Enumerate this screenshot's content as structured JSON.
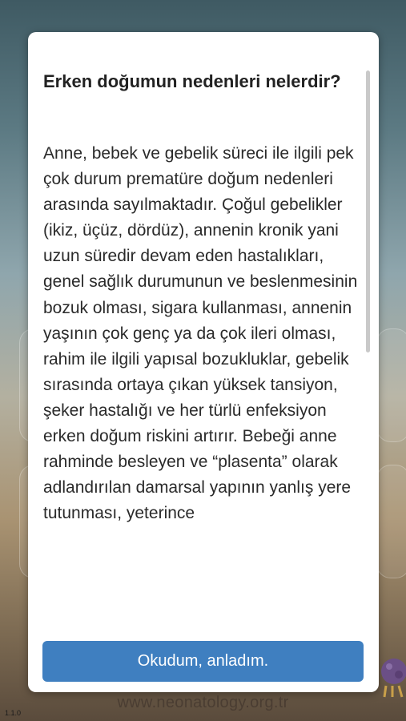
{
  "dialog": {
    "title": "Erken doğumun nedenleri nelerdir?",
    "body": "Anne, bebek ve gebelik süreci ile ilgili pek çok durum prematüre doğum nedenleri arasında sayılmaktadır. Çoğul gebelikler (ikiz, üçüz, dördüz), annenin kronik yani uzun süredir devam eden hastalıkları, genel sağlık durumunun ve beslenmesinin bozuk olması, sigara kullanması, annenin yaşının çok genç ya da çok ileri olması, rahim ile ilgili yapısal bozukluklar, gebelik sırasında ortaya çıkan yüksek tansiyon, şeker hastalığı ve her türlü enfeksiyon erken doğum riskini artırır. Bebeği anne rahminde besleyen ve “plasenta” olarak adlandırılan damarsal yapının yanlış yere tutunması, yeterince",
    "ok_label": "Okudum, anladım."
  },
  "footer": {
    "url": "www.neonatology.org.tr",
    "version": "1.1.0"
  },
  "colors": {
    "button": "#3f7fc0",
    "dialog_bg": "#ffffff"
  },
  "icons": {
    "mascot": "purple-mascot-icon"
  }
}
